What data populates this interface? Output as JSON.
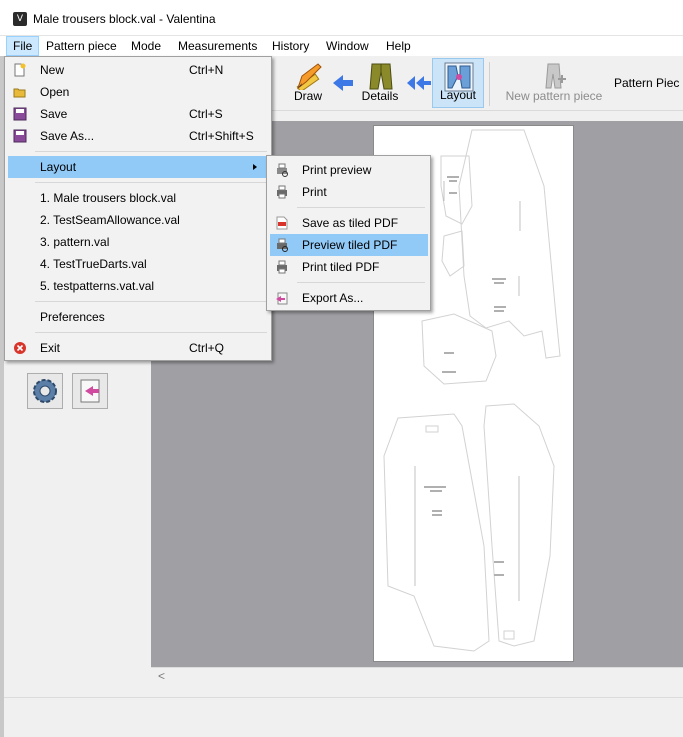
{
  "window": {
    "title": "Male trousers block.val - Valentina",
    "app_icon": "valentina-logo-icon"
  },
  "menubar": {
    "items": [
      {
        "label": "File",
        "active": true
      },
      {
        "label": "Pattern piece"
      },
      {
        "label": "Mode"
      },
      {
        "label": "Measurements"
      },
      {
        "label": "History"
      },
      {
        "label": "Window"
      },
      {
        "label": "Help"
      }
    ]
  },
  "toolbar": {
    "draw": {
      "label": "Draw",
      "icon": "pencil-ruler-icon"
    },
    "details": {
      "label": "Details",
      "icon": "trousers-icon"
    },
    "layout": {
      "label": "Layout",
      "icon": "layout-pieces-icon",
      "active": true
    },
    "new_pattern_piece": {
      "label": "New pattern piece",
      "icon": "new-pattern-piece-icon",
      "enabled": false
    },
    "pattern_piece_label": "Pattern Piec"
  },
  "file_menu": {
    "items": [
      {
        "label": "New",
        "shortcut": "Ctrl+N",
        "icon": "new-file-icon"
      },
      {
        "label": "Open",
        "shortcut": "",
        "icon": "open-folder-icon"
      },
      {
        "label": "Save",
        "shortcut": "Ctrl+S",
        "icon": "save-icon"
      },
      {
        "label": "Save As...",
        "shortcut": "Ctrl+Shift+S",
        "icon": "save-as-icon"
      },
      {
        "label": "Layout",
        "submenu": true,
        "highlighted": true
      },
      {
        "label": "1. Male trousers block.val"
      },
      {
        "label": "2. TestSeamAllowance.val"
      },
      {
        "label": "3. pattern.val"
      },
      {
        "label": "4. TestTrueDarts.val"
      },
      {
        "label": "5. testpatterns.vat.val"
      },
      {
        "label": "Preferences"
      },
      {
        "label": "Exit",
        "shortcut": "Ctrl+Q",
        "icon": "exit-icon"
      }
    ]
  },
  "layout_submenu": {
    "items": [
      {
        "label": "Print preview",
        "icon": "print-preview-icon"
      },
      {
        "label": "Print",
        "icon": "printer-icon"
      },
      {
        "label": "Save as tiled PDF",
        "icon": "pdf-icon"
      },
      {
        "label": "Preview tiled PDF",
        "icon": "print-preview-tiled-icon",
        "highlighted": true
      },
      {
        "label": "Print tiled PDF",
        "icon": "printer-tiled-icon"
      },
      {
        "label": "Export As...",
        "icon": "export-icon"
      }
    ]
  },
  "colors": {
    "accent": "#91c9f7",
    "toolbar_active": "#cce4f7",
    "canvas_bg": "#a0a0a4",
    "arrow_blue": "#3c78e6"
  }
}
